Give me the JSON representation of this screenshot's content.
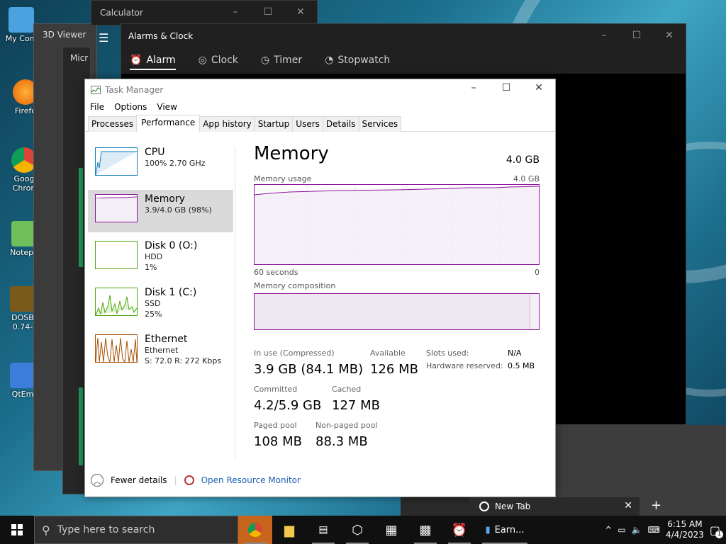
{
  "desktop": {
    "icons": [
      {
        "label": "My Com",
        "color": "#4aa3df"
      },
      {
        "label": "Firefo",
        "color": "#e66000"
      },
      {
        "label": "Goog",
        "label2": "Chron",
        "color": "#db4437"
      },
      {
        "label": "Notepa",
        "color": "#6fbf5b"
      },
      {
        "label": "DOSB",
        "label2": "0.74-",
        "color": "#7a5a1a"
      },
      {
        "label": "QtEm",
        "color": "#3b7dd8"
      }
    ]
  },
  "windows": {
    "calculator_title": "Calculator",
    "viewer_title": "3D Viewer",
    "ms_title": "Micr",
    "alarm": {
      "title": "Alarms & Clock",
      "tabs": [
        "Alarm",
        "Clock",
        "Timer",
        "Stopwatch"
      ]
    }
  },
  "taskmgr": {
    "title": "Task Manager",
    "menu": [
      "File",
      "Options",
      "View"
    ],
    "tabs": [
      "Processes",
      "Performance",
      "App history",
      "Startup",
      "Users",
      "Details",
      "Services"
    ],
    "side": [
      {
        "name": "CPU",
        "sub1": "100% 2.70 GHz",
        "sub2": ""
      },
      {
        "name": "Memory",
        "sub1": "3.9/4.0 GB (98%)",
        "sub2": ""
      },
      {
        "name": "Disk 0 (O:)",
        "sub1": "HDD",
        "sub2": "1%"
      },
      {
        "name": "Disk 1 (C:)",
        "sub1": "SSD",
        "sub2": "25%"
      },
      {
        "name": "Ethernet",
        "sub1": "Ethernet",
        "sub2": "S: 72.0  R: 272 Kbps"
      }
    ],
    "main": {
      "title": "Memory",
      "total": "4.0 GB",
      "usage_label": "Memory usage",
      "usage_max": "4.0 GB",
      "axis_left": "60 seconds",
      "axis_right": "0",
      "composition_label": "Memory composition",
      "in_use_label": "In use (Compressed)",
      "in_use_value": "3.9 GB (84.1 MB)",
      "available_label": "Available",
      "available_value": "126 MB",
      "committed_label": "Committed",
      "committed_value": "4.2/5.9 GB",
      "cached_label": "Cached",
      "cached_value": "127 MB",
      "paged_label": "Paged pool",
      "paged_value": "108 MB",
      "nonpaged_label": "Non-paged pool",
      "nonpaged_value": "88.3 MB",
      "slots_label": "Slots used:",
      "slots_value": "N/A",
      "hw_label": "Hardware reserved:",
      "hw_value": "0.5 MB"
    },
    "footer": {
      "fewer": "Fewer details",
      "resource": "Open Resource Monitor"
    }
  },
  "newtab": {
    "label": "New Tab"
  },
  "taskbar": {
    "search_placeholder": "Type here to search",
    "app_label": "Earn...",
    "time": "6:15 AM",
    "date": "4/4/2023",
    "notif_count": "1"
  }
}
